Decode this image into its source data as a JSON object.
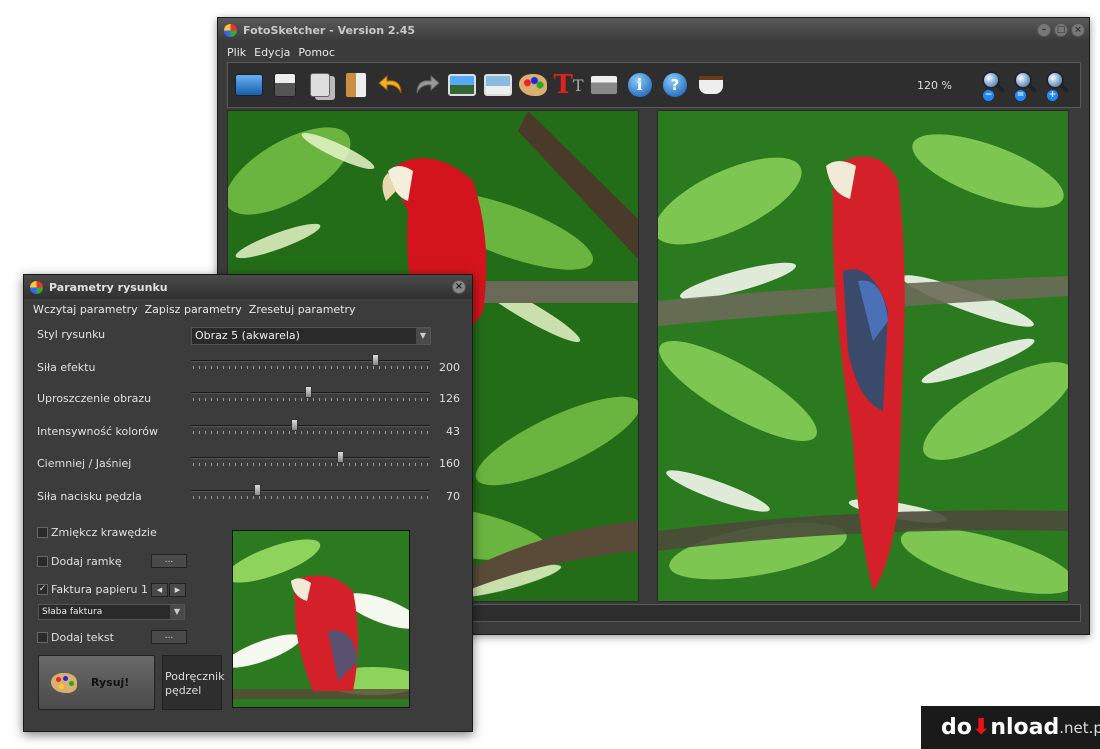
{
  "window": {
    "title": "FotoSketcher - Version 2.45",
    "menu": [
      "Plik",
      "Edycja",
      "Pomoc"
    ],
    "zoom": "120 %"
  },
  "toolbar": {
    "icons": [
      "open-icon",
      "save-icon",
      "copy-icon",
      "paste-icon",
      "undo-icon",
      "redo-icon",
      "original-image-icon",
      "result-image-icon",
      "palette-icon",
      "text-icon",
      "print-icon",
      "info-icon",
      "help-icon",
      "coffee-icon"
    ],
    "zoom_icons": [
      "zoom-out-icon",
      "zoom-fit-icon",
      "zoom-in-icon"
    ]
  },
  "dialog": {
    "title": "Parametry rysunku",
    "menu": [
      "Wczytaj parametry",
      "Zapisz parametry",
      "Zresetuj parametry"
    ],
    "style_label": "Styl rysunku",
    "style_value": "Obraz 5 (akwarela)",
    "sliders": [
      {
        "label": "Siła efektu",
        "value": "200",
        "fraction": 0.78
      },
      {
        "label": "Uproszczenie obrazu",
        "value": "126",
        "fraction": 0.49
      },
      {
        "label": "Intensywność kolorów",
        "value": "43",
        "fraction": 0.43
      },
      {
        "label": "Ciemniej / Jaśniej",
        "value": "160",
        "fraction": 0.63
      },
      {
        "label": "Siła nacisku pędzla",
        "value": "70",
        "fraction": 0.27
      }
    ],
    "checkboxes": [
      {
        "label": "Zmiękcz krawędzie",
        "checked": false
      },
      {
        "label": "Dodaj ramkę",
        "checked": false
      },
      {
        "label": "Faktura papieru 1",
        "checked": true
      },
      {
        "label": "Dodaj tekst",
        "checked": false
      }
    ],
    "dots_label": "...",
    "texture_value": "Słaba faktura",
    "draw_button": "Rysuj!",
    "brush_button": "Podręcznik pędzel"
  },
  "logo": {
    "pre": "do",
    "arrow": "⬇",
    "post": "nload",
    "tld": ".net.pl"
  }
}
